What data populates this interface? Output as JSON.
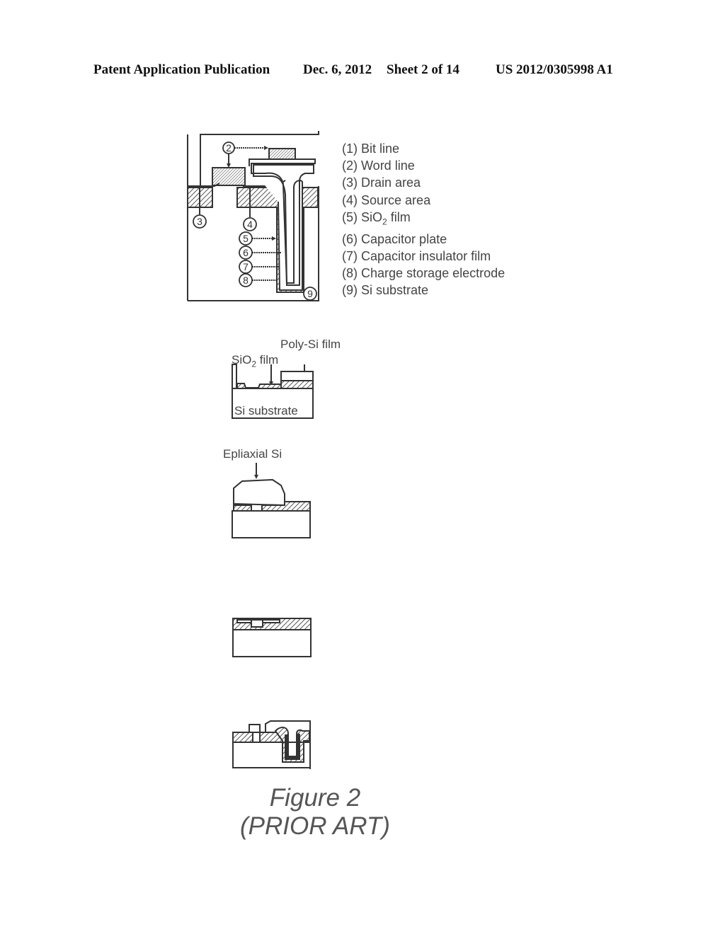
{
  "header": {
    "publication": "Patent Application Publication",
    "date": "Dec. 6, 2012",
    "sheet": "Sheet 2 of 14",
    "number": "US 2012/0305998 A1"
  },
  "legend": [
    {
      "num": "(1)",
      "text": "Bit line"
    },
    {
      "num": "(2)",
      "text": "Word line"
    },
    {
      "num": "(3)",
      "text": "Drain area"
    },
    {
      "num": "(4)",
      "text": "Source area"
    },
    {
      "num": "(5)",
      "text": "SiO",
      "sub": "2",
      "after": " film"
    },
    {
      "num": "(6)",
      "text": "Capacitor plate"
    },
    {
      "num": "(7)",
      "text": "Capacitor insulator film"
    },
    {
      "num": "(8)",
      "text": "Charge storage electrode"
    },
    {
      "num": "(9)",
      "text": "Si substrate"
    }
  ],
  "callouts": [
    "2",
    "3",
    "4",
    "5",
    "6",
    "7",
    "8",
    "9"
  ],
  "step1": {
    "poly_label": "Poly-Si film",
    "sio2_label": "SiO",
    "sio2_sub": "2",
    "sio2_after": " film",
    "substrate_label": "Si substrate"
  },
  "step2": {
    "epi_label": "Epliaxial Si"
  },
  "caption": {
    "line1": "Figure 2",
    "line2": "(PRIOR ART)"
  }
}
